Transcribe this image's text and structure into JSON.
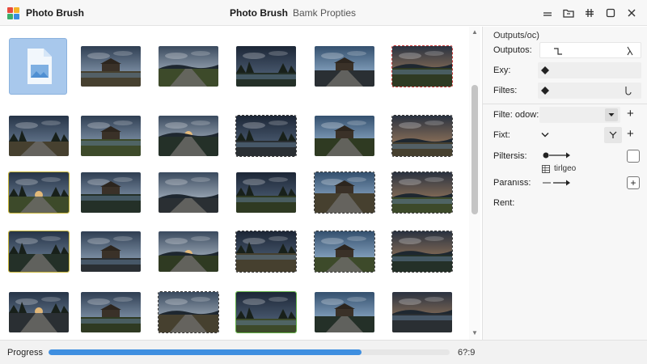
{
  "app": {
    "title": "Photo Brush",
    "center_title_primary": "Photo Brush",
    "center_title_secondary": "Bamk Proptiеs"
  },
  "window_controls": [
    "minimize-icon",
    "folder-icon",
    "hash-icon",
    "maximize-icon",
    "close-icon"
  ],
  "grid": {
    "file_tile_icon": "image-file-icon",
    "rows": 5,
    "columns": 6
  },
  "panel": {
    "header": "Outputs/oc)",
    "outputs_label": "Outputos:",
    "exy_label": "Exy:",
    "filtes_label": "Filtes:",
    "filter_label": "Filte: odow:",
    "fixt_label": "Fixt:",
    "piltersis_label": "Piltersis:",
    "piltersis_sub": "tirlgeo",
    "paransss_label": "Paranıss:",
    "rent_label": "Rent:"
  },
  "status": {
    "progress_label": "Progress",
    "progress_fraction": 0.78,
    "progress_count": "6?:9"
  },
  "colors": {
    "accent": "#3f8fe0",
    "file_tile": "#a8c8ec"
  }
}
